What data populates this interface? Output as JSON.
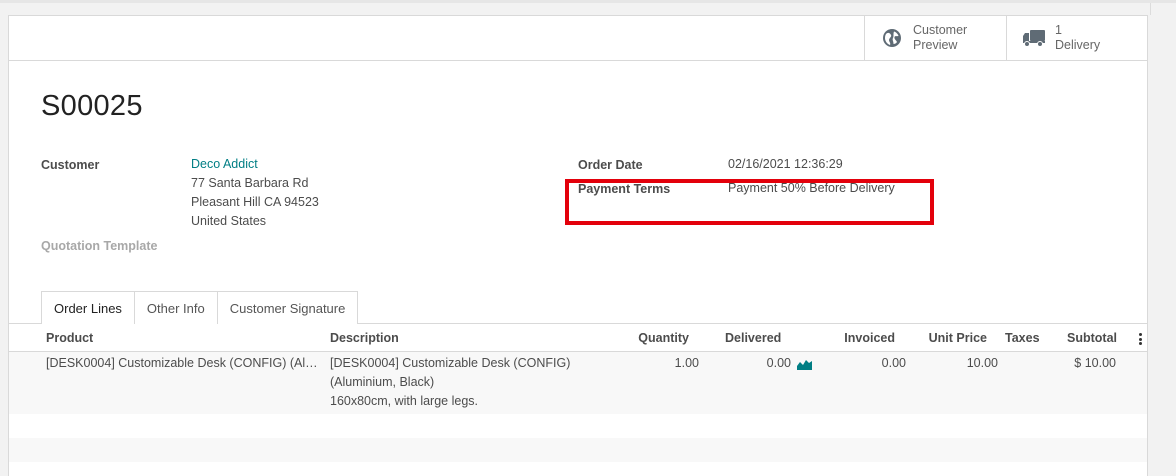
{
  "stat_buttons": {
    "preview": {
      "line1": "Customer",
      "line2": "Preview",
      "icon": "globe-icon"
    },
    "delivery": {
      "count": "1",
      "label": "Delivery",
      "icon": "truck-icon"
    }
  },
  "order": {
    "name": "S00025",
    "customer_label": "Customer",
    "customer_name": "Deco Addict",
    "address_line1": "77 Santa Barbara Rd",
    "address_line2": "Pleasant Hill CA 94523",
    "address_line3": "United States",
    "template_label": "Quotation Template",
    "order_date_label": "Order Date",
    "order_date": "02/16/2021 12:36:29",
    "payment_terms_label": "Payment Terms",
    "payment_terms": "Payment 50% Before Delivery"
  },
  "tabs": [
    "Order Lines",
    "Other Info",
    "Customer Signature"
  ],
  "columns": {
    "product": "Product",
    "description": "Description",
    "quantity": "Quantity",
    "delivered": "Delivered",
    "invoiced": "Invoiced",
    "unit_price": "Unit Price",
    "taxes": "Taxes",
    "subtotal": "Subtotal"
  },
  "lines": [
    {
      "product": "[DESK0004] Customizable Desk (CONFIG) (Al…",
      "description_1": "[DESK0004] Customizable Desk (CONFIG)",
      "description_2": "(Aluminium, Black)",
      "description_3": "160x80cm, with large legs.",
      "quantity": "1.00",
      "delivered": "0.00",
      "invoiced": "0.00",
      "unit_price": "10.00",
      "taxes": "",
      "subtotal": "$ 10.00"
    }
  ],
  "colors": {
    "accent": "#017e84",
    "highlight": "#e3000b"
  }
}
